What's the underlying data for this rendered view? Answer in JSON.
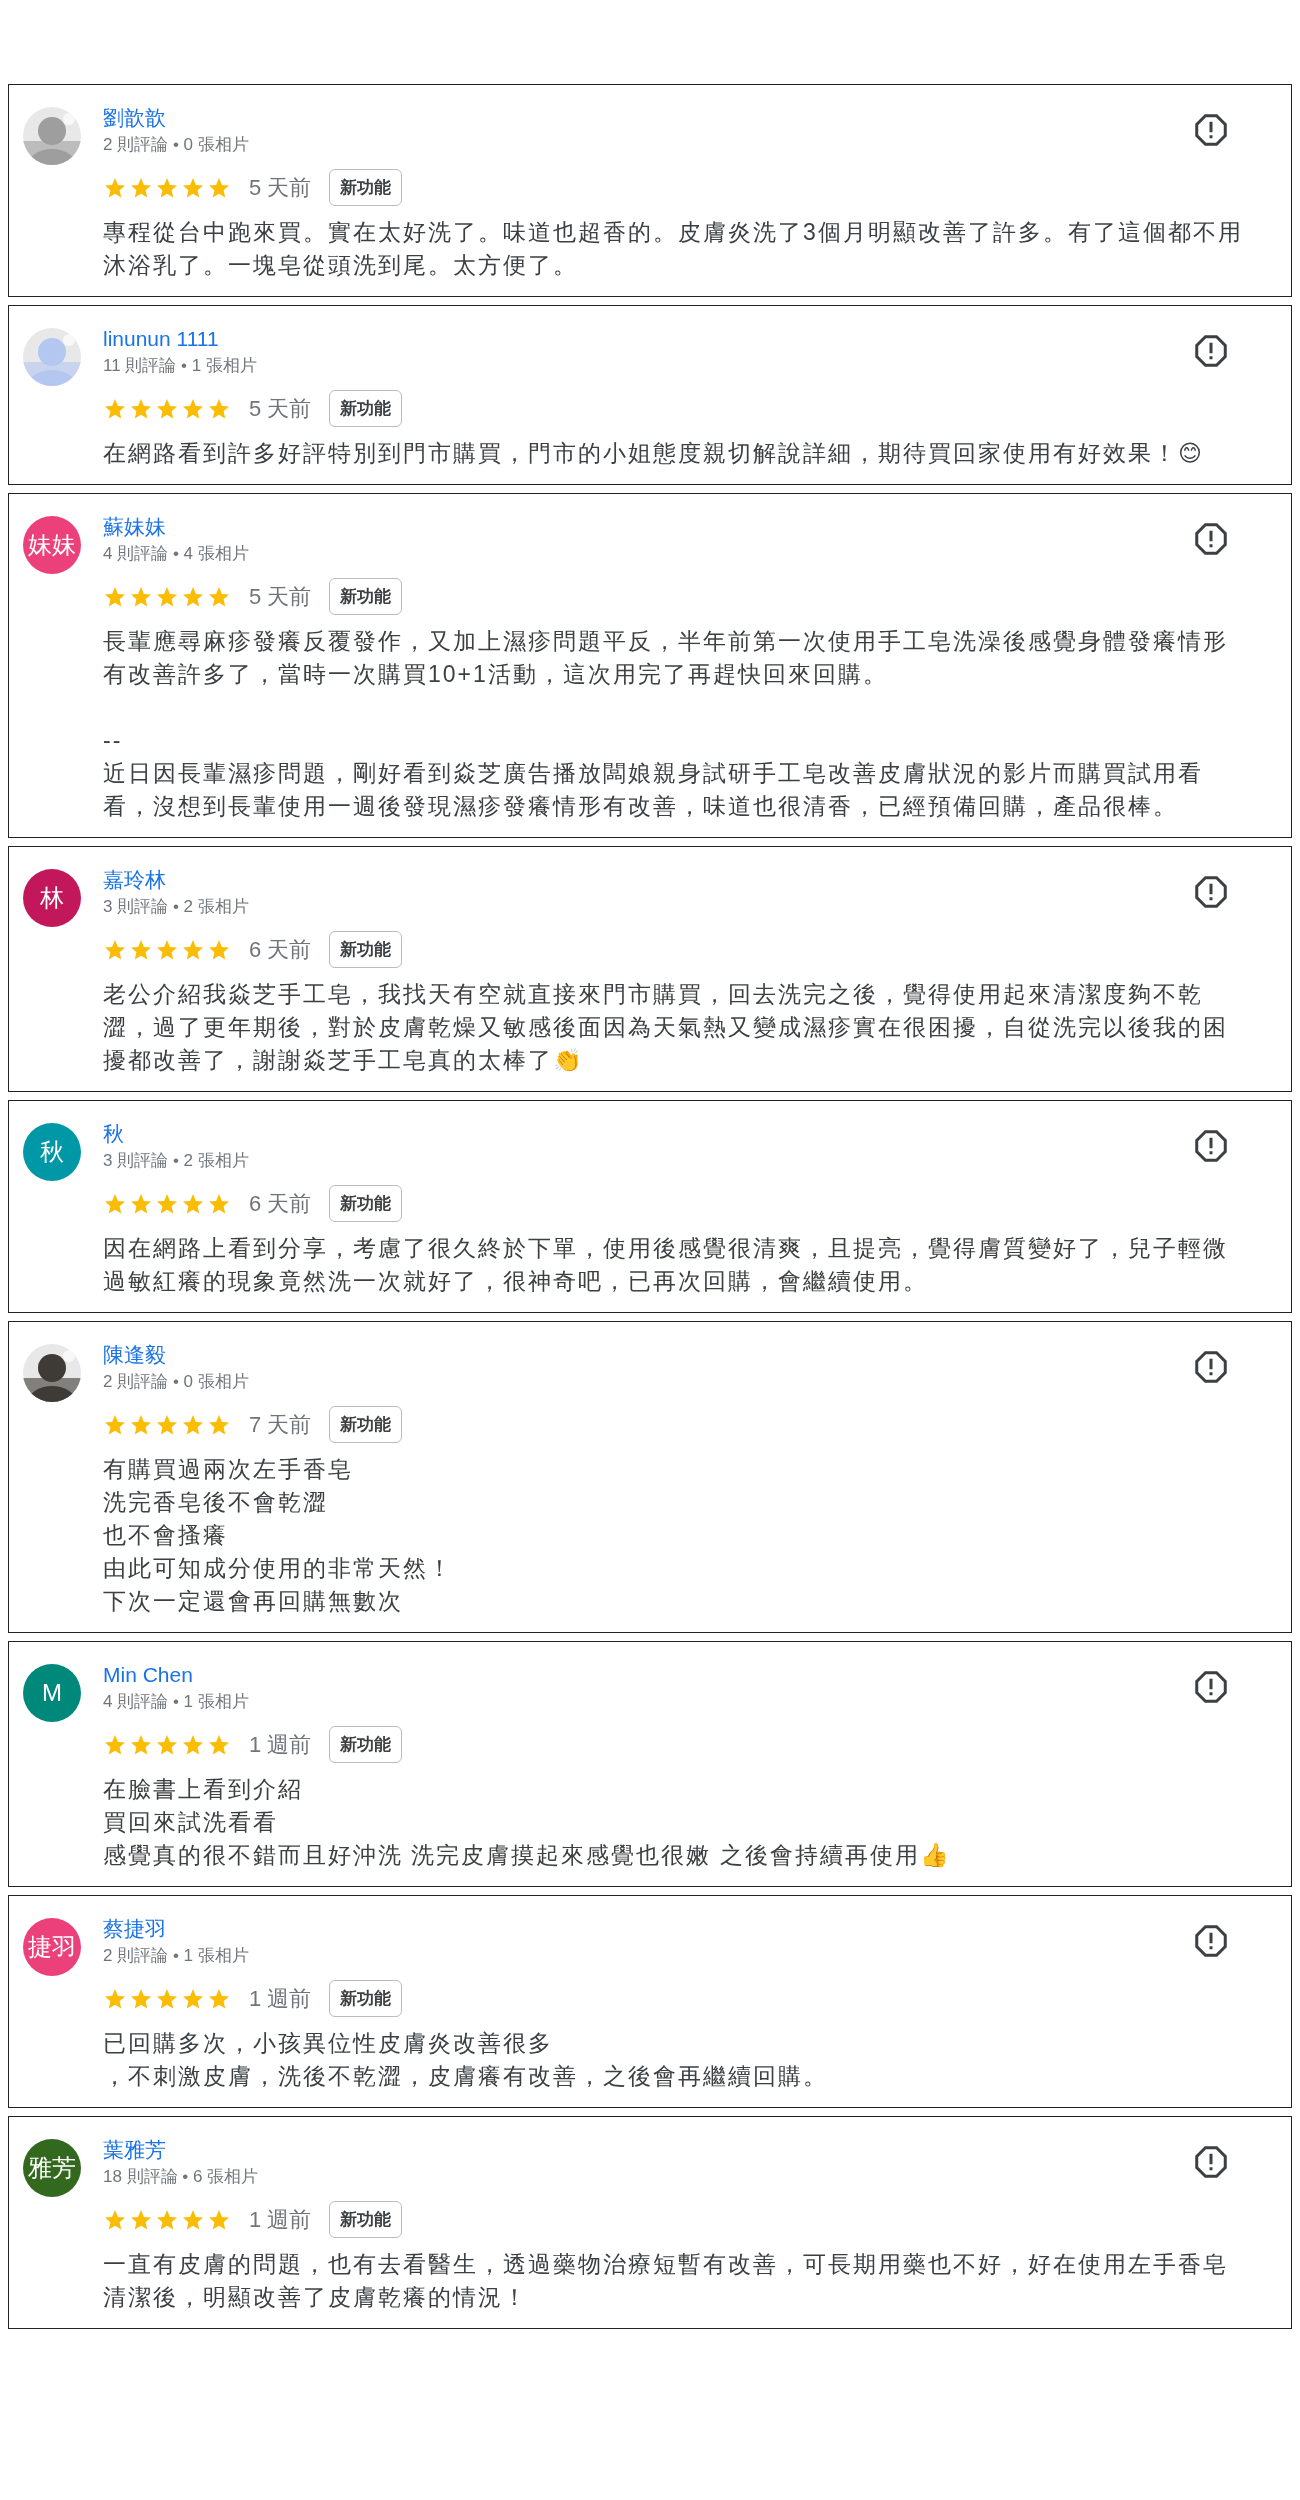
{
  "reviews": [
    {
      "name": "劉歆歆",
      "stats": "2 則評論 • 0 張相片",
      "stars": 5,
      "time": "5 天前",
      "badge": "新功能",
      "text": "專程從台中跑來買。實在太好洗了。味道也超香的。皮膚炎洗了3個月明顯改善了許多。有了這個都不用沐浴乳了。一塊皂從頭洗到尾。太方便了。"
    },
    {
      "name": "linunun 1111",
      "stats": "11 則評論 • 1 張相片",
      "stars": 5,
      "time": "5 天前",
      "badge": "新功能",
      "text": "在網路看到許多好評特別到門市購買，門市的小姐態度親切解說詳細，期待買回家使用有好效果！😊"
    },
    {
      "name": "蘇妹妹",
      "avatar": {
        "kind": "letter",
        "text": "妹妹",
        "color": "#ec407a"
      },
      "stats": "4 則評論 • 4 張相片",
      "stars": 5,
      "time": "5 天前",
      "badge": "新功能",
      "text": "長輩應尋麻疹發癢反覆發作，又加上濕疹問題平反，半年前第一次使用手工皂洗澡後感覺身體發癢情形有改善許多了，當時一次購買10+1活動，這次用完了再趕快回來回購。\n\n--\n近日因長輩濕疹問題，剛好看到焱芝廣告播放闆娘親身試研手工皂改善皮膚狀況的影片而購買試用看看，沒想到長輩使用一週後發現濕疹發癢情形有改善，味道也很清香，已經預備回購，產品很棒。"
    },
    {
      "name": "嘉玲林",
      "avatar": {
        "kind": "letter",
        "text": "林",
        "color": "#c2185b"
      },
      "stats": "3 則評論 • 2 張相片",
      "stars": 5,
      "time": "6 天前",
      "badge": "新功能",
      "text": "老公介紹我焱芝手工皂，我找天有空就直接來門市購買，回去洗完之後，覺得使用起來清潔度夠不乾澀，過了更年期後，對於皮膚乾燥又敏感後面因為天氣熱又變成濕疹實在很困擾，自從洗完以後我的困擾都改善了，謝謝焱芝手工皂真的太棒了👏"
    },
    {
      "name": "秋",
      "avatar": {
        "kind": "letter",
        "text": "秋",
        "color": "#0097a7"
      },
      "stats": "3 則評論 • 2 張相片",
      "stars": 5,
      "time": "6 天前",
      "badge": "新功能",
      "text": "因在網路上看到分享，考慮了很久終於下單，使用後感覺很清爽，且提亮，覺得膚質變好了，兒子輕微過敏紅癢的現象竟然洗一次就好了，很神奇吧，已再次回購，會繼續使用。"
    },
    {
      "name": "陳逢毅",
      "stats": "2 則評論 • 0 張相片",
      "stars": 5,
      "time": "7 天前",
      "badge": "新功能",
      "text": [
        "有購買過兩次左手香皂",
        "洗完香皂後不會乾澀",
        "也不會搔癢",
        "由此可知成分使用的非常天然！",
        "下次一定還會再回購無數次"
      ]
    },
    {
      "name": "Min Chen",
      "avatar": {
        "kind": "letter",
        "text": "M",
        "color": "#00897b"
      },
      "stats": "4 則評論 • 1 張相片",
      "stars": 5,
      "time": "1 週前",
      "badge": "新功能",
      "text": [
        "在臉書上看到介紹",
        "買回來試洗看看",
        "感覺真的很不錯而且好沖洗 洗完皮膚摸起來感覺也很嫩 之後會持續再使用👍"
      ]
    },
    {
      "name": "蔡捷羽",
      "avatar": {
        "kind": "letter",
        "text": "捷羽",
        "color": "#ec407a"
      },
      "stats": "2 則評論 • 1 張相片",
      "stars": 5,
      "time": "1 週前",
      "badge": "新功能",
      "text": [
        "已回購多次，小孩異位性皮膚炎改善很多",
        "，不刺激皮膚，洗後不乾澀，皮膚癢有改善，之後會再繼續回購。"
      ]
    },
    {
      "name": "葉雅芳",
      "avatar": {
        "kind": "letter",
        "text": "雅芳",
        "color": "#33691e"
      },
      "stats": "18 則評論 • 6 張相片",
      "stars": 5,
      "time": "1 週前",
      "badge": "新功能",
      "text": "一直有皮膚的問題，也有去看醫生，透過藥物治療短暫有改善，可長期用藥也不好，好在使用左手香皂清潔後，明顯改善了皮膚乾癢的情況！"
    }
  ]
}
